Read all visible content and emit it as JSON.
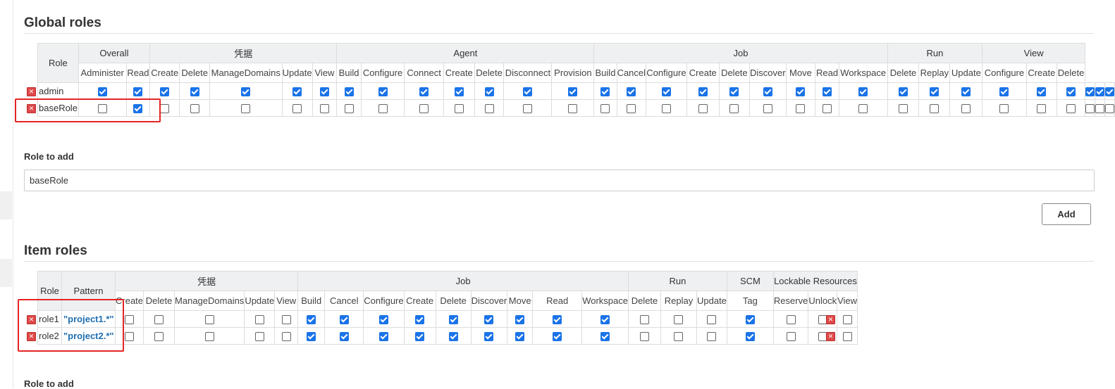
{
  "global": {
    "title": "Global roles",
    "role_header": "Role",
    "groups": [
      {
        "label": "Overall",
        "perms": [
          "Administer",
          "Read"
        ]
      },
      {
        "label": "凭据",
        "perms": [
          "Create",
          "Delete",
          "ManageDomains",
          "Update",
          "View"
        ]
      },
      {
        "label": "Agent",
        "perms": [
          "Build",
          "Configure",
          "Connect",
          "Create",
          "Delete",
          "Disconnect",
          "Provision"
        ]
      },
      {
        "label": "Job",
        "perms": [
          "Build",
          "Cancel",
          "Configure",
          "Create",
          "Delete",
          "Discover",
          "Move",
          "Read",
          "Workspace"
        ]
      },
      {
        "label": "Run",
        "perms": [
          "Delete",
          "Replay",
          "Update"
        ]
      },
      {
        "label": "View",
        "perms": [
          "Configure",
          "Create",
          "Delete"
        ]
      }
    ],
    "rows": [
      {
        "name": "admin",
        "checks": [
          1,
          1,
          1,
          1,
          1,
          1,
          1,
          1,
          1,
          1,
          1,
          1,
          1,
          1,
          1,
          1,
          1,
          1,
          1,
          1,
          1,
          1,
          1,
          1,
          1,
          1,
          1,
          1,
          1,
          1,
          1,
          1
        ]
      },
      {
        "name": "baseRole",
        "checks": [
          0,
          1,
          0,
          0,
          0,
          0,
          0,
          0,
          0,
          0,
          0,
          0,
          0,
          0,
          0,
          0,
          0,
          0,
          0,
          0,
          0,
          0,
          0,
          0,
          0,
          0,
          0,
          0,
          0,
          0,
          0,
          0
        ]
      }
    ],
    "add_label": "Role to add",
    "add_value": "baseRole",
    "add_button": "Add"
  },
  "item": {
    "title": "Item roles",
    "role_header": "Role",
    "pattern_header": "Pattern",
    "groups": [
      {
        "label": "凭据",
        "perms": [
          "Create",
          "Delete",
          "ManageDomains",
          "Update",
          "View"
        ]
      },
      {
        "label": "Job",
        "perms": [
          "Build",
          "Cancel",
          "Configure",
          "Create",
          "Delete",
          "Discover",
          "Move",
          "Read",
          "Workspace"
        ]
      },
      {
        "label": "Run",
        "perms": [
          "Delete",
          "Replay",
          "Update"
        ]
      },
      {
        "label": "SCM",
        "perms": [
          "Tag"
        ]
      },
      {
        "label": "Lockable Resources",
        "perms": [
          "Reserve",
          "Unlock",
          "View"
        ]
      }
    ],
    "rows": [
      {
        "name": "role1",
        "pattern": "\"project1.*\"",
        "checks": [
          0,
          0,
          0,
          0,
          0,
          1,
          1,
          1,
          1,
          1,
          1,
          1,
          1,
          1,
          0,
          0,
          0,
          1,
          0,
          0,
          0
        ]
      },
      {
        "name": "role2",
        "pattern": "\"project2.*\"",
        "checks": [
          0,
          0,
          0,
          0,
          0,
          1,
          1,
          1,
          1,
          1,
          1,
          1,
          1,
          1,
          0,
          0,
          0,
          1,
          0,
          0,
          0
        ]
      }
    ],
    "add_label": "Role to add"
  }
}
